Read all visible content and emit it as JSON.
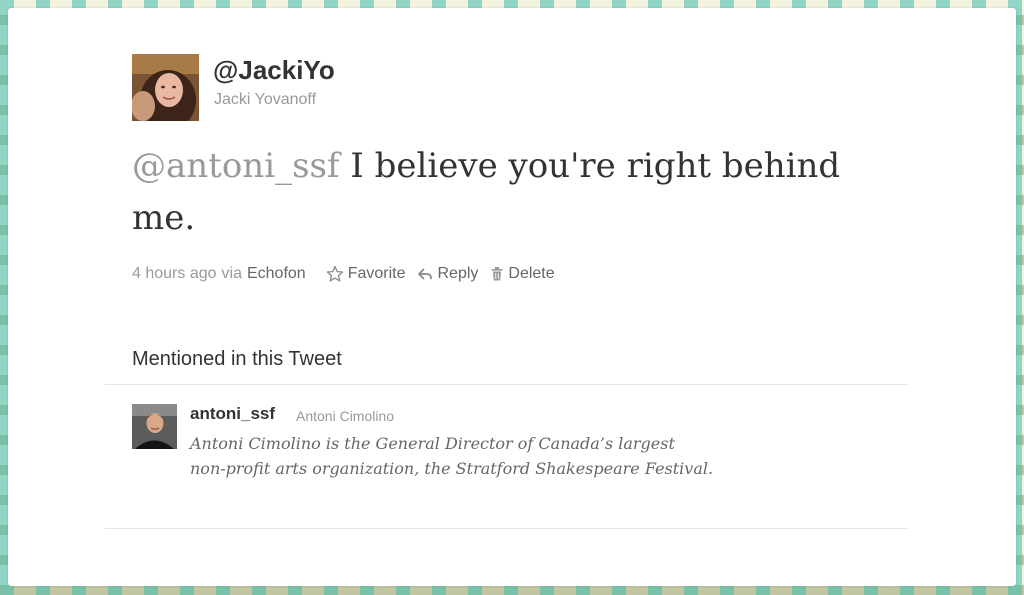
{
  "tweet": {
    "handle": "@JackiYo",
    "name": "Jacki Yovanoff",
    "avatar": "profile-photo",
    "mention": "@antoni_ssf",
    "text_line1": "I believe you're right behind",
    "text_line2": "me.",
    "time": "4 hours ago",
    "via": "via",
    "client": "Echofon"
  },
  "actions": {
    "favorite": {
      "icon": "star-icon",
      "label": "Favorite"
    },
    "reply": {
      "icon": "reply-arrow-icon",
      "label": "Reply"
    },
    "delete": {
      "icon": "trash-icon",
      "label": "Delete"
    }
  },
  "mentioned": {
    "title": "Mentioned in this Tweet",
    "users": [
      {
        "handle": "antoni_ssf",
        "name": "Antoni Cimolino",
        "bio_line1": "Antoni Cimolino is the General Director of Canada’s largest",
        "bio_line2": "non-profit arts organization, the Stratford Shakespeare Festival."
      }
    ]
  },
  "colors": {
    "background_teal": "#40beb0",
    "background_olive": "#848c56",
    "text_dark": "#333333",
    "text_muted": "#999999"
  }
}
